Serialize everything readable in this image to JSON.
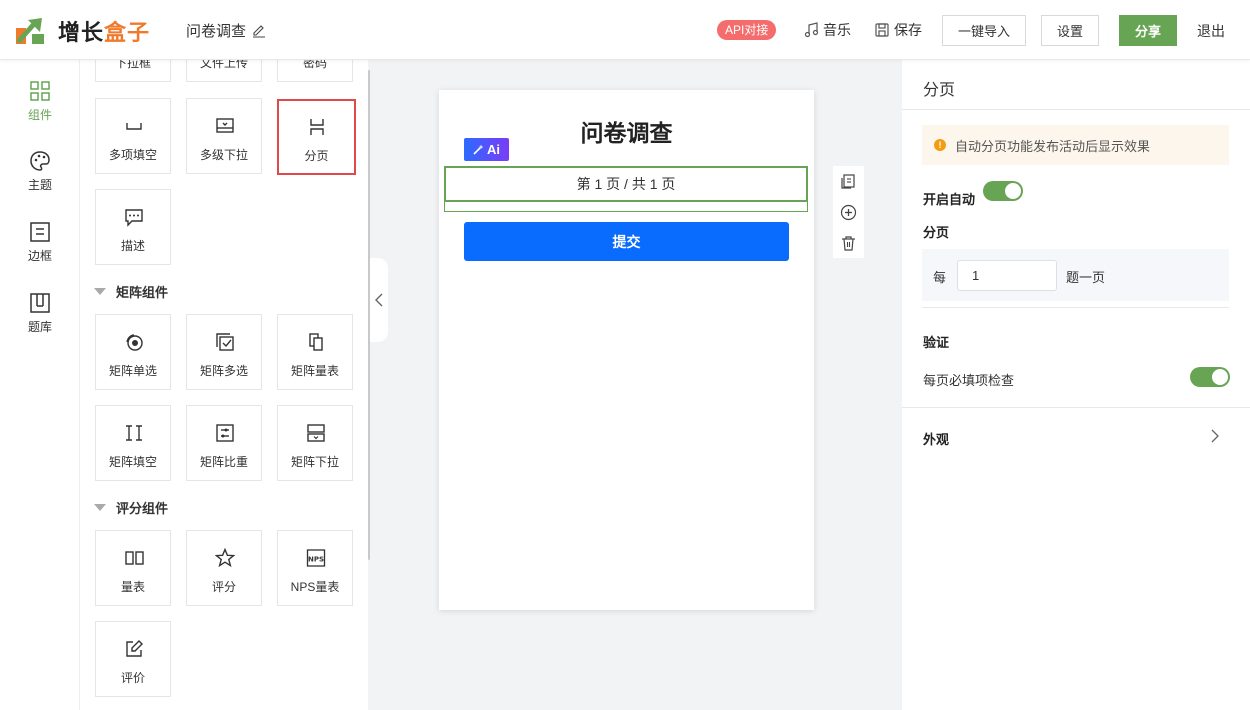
{
  "header": {
    "logo_text_main": "增长",
    "logo_text_accent": "盒子",
    "doc_title": "问卷调查",
    "api_badge": "API对接",
    "music_label": "音乐",
    "save_label": "保存",
    "import_label": "一键导入",
    "settings_label": "设置",
    "share_label": "分享",
    "logout_label": "退出"
  },
  "rail": {
    "items": [
      {
        "label": "组件",
        "icon": "components-grid-icon"
      },
      {
        "label": "主题",
        "icon": "palette-icon"
      },
      {
        "label": "边框",
        "icon": "border-frame-icon"
      },
      {
        "label": "题库",
        "icon": "question-bank-icon"
      }
    ]
  },
  "panel": {
    "partial_tiles": [
      "下拉框",
      "文件上传",
      "密码"
    ],
    "basic_tiles": [
      "多项填空",
      "多级下拉",
      "分页",
      "描述"
    ],
    "matrix_group": "矩阵组件",
    "matrix_tiles": [
      "矩阵单选",
      "矩阵多选",
      "矩阵量表",
      "矩阵填空",
      "矩阵比重",
      "矩阵下拉"
    ],
    "rating_group": "评分组件",
    "rating_tiles": [
      "量表",
      "评分",
      "NPS量表",
      "评价"
    ],
    "selected_tile": "分页"
  },
  "canvas": {
    "survey_title": "问卷调查",
    "ai_badge": "Ai",
    "page_indicator": "第 1 页 / 共 1 页",
    "submit_label": "提交"
  },
  "settings": {
    "title": "分页",
    "notice": "自动分页功能发布活动后显示效果",
    "auto_label": "开启自动",
    "auto_enabled": true,
    "paging_label": "分页",
    "per_prefix": "每",
    "per_value": "1",
    "per_suffix": "题一页",
    "validate_label": "验证",
    "validate_text": "每页必填项检查",
    "validate_enabled": true,
    "appearance_label": "外观"
  },
  "colors": {
    "brand_green": "#67a554",
    "brand_orange": "#f07a2c",
    "submit_blue": "#0a6bff",
    "api_red": "#f56c6c",
    "selected_border": "#e0484a"
  }
}
